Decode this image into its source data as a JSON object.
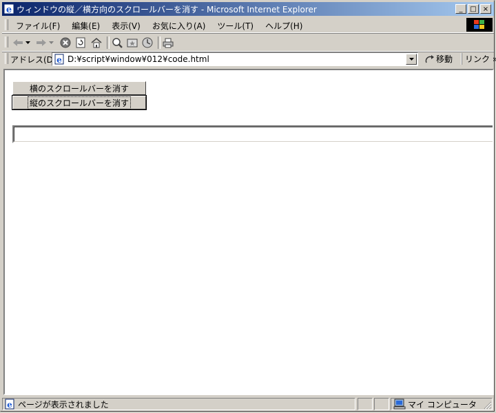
{
  "window": {
    "title": "ウィンドウの縦／横方向のスクロールバーを消す - Microsoft Internet Explorer",
    "caption_buttons": {
      "minimize": "_",
      "maximize": "□",
      "close": "×"
    }
  },
  "menu": {
    "items": [
      "ファイル(F)",
      "編集(E)",
      "表示(V)",
      "お気に入り(A)",
      "ツール(T)",
      "ヘルプ(H)"
    ]
  },
  "toolbar": {
    "icons": [
      "back-icon",
      "dropdown-icon",
      "forward-icon",
      "dropdown-icon",
      "stop-icon",
      "refresh-icon",
      "home-icon",
      "search-icon",
      "favorites-icon",
      "history-icon",
      "print-icon"
    ]
  },
  "address_bar": {
    "label": "アドレス(D)",
    "url": "D:¥script¥window¥012¥code.html",
    "go_label": "移動",
    "links_label": "リンク »"
  },
  "page": {
    "buttons": [
      "横のスクロールバーを消す",
      "縦のスクロールバーを消す"
    ],
    "text_field_value": ""
  },
  "status_bar": {
    "text": "ページが表示されました",
    "zone": "マイ コンピュータ"
  }
}
